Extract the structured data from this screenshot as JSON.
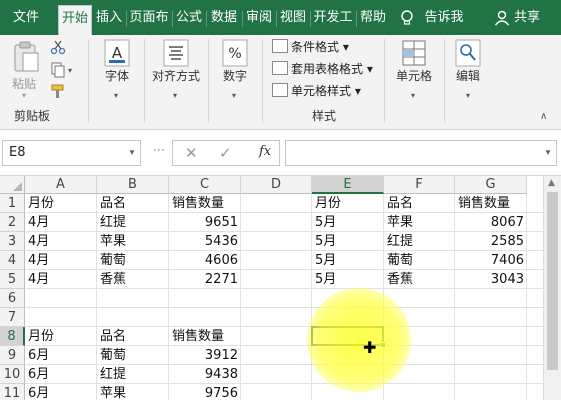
{
  "tabs": [
    {
      "label": "文件",
      "active": false
    },
    {
      "label": "开始",
      "active": true
    },
    {
      "label": "插入",
      "active": false
    },
    {
      "label": "页面布",
      "active": false
    },
    {
      "label": "公式",
      "active": false
    },
    {
      "label": "数据",
      "active": false
    },
    {
      "label": "审阅",
      "active": false
    },
    {
      "label": "视图",
      "active": false
    },
    {
      "label": "开发工",
      "active": false
    },
    {
      "label": "帮助",
      "active": false
    }
  ],
  "tell_me": {
    "icon": "lightbulb-icon",
    "label": "告诉我"
  },
  "share": {
    "icon": "person-icon",
    "label": "共享"
  },
  "ribbon": {
    "clipboard": {
      "paste_label": "粘贴",
      "group_name": "剪贴板"
    },
    "font": {
      "label": "字体"
    },
    "alignment": {
      "label": "对齐方式"
    },
    "number": {
      "label": "数字"
    },
    "styles": {
      "items": [
        "条件格式",
        "套用表格格式",
        "单元格样式"
      ],
      "group_name": "样式"
    },
    "cells": {
      "label": "单元格"
    },
    "editing": {
      "label": "编辑"
    }
  },
  "formula_bar": {
    "name_box": "E8",
    "fx_label": "fx",
    "formula": ""
  },
  "grid": {
    "columns": [
      "A",
      "B",
      "C",
      "D",
      "E",
      "F",
      "G"
    ],
    "selected_column": "E",
    "rows": [
      "1",
      "2",
      "3",
      "4",
      "5",
      "6",
      "7",
      "8",
      "9",
      "10",
      "11"
    ],
    "selected_row": "8",
    "table1": {
      "headers": [
        "月份",
        "品名",
        "销售数量"
      ],
      "rows": [
        [
          "4月",
          "红提",
          "9651"
        ],
        [
          "4月",
          "苹果",
          "5436"
        ],
        [
          "4月",
          "葡萄",
          "4606"
        ],
        [
          "4月",
          "香蕉",
          "2271"
        ]
      ]
    },
    "table2": {
      "headers": [
        "月份",
        "品名",
        "销售数量"
      ],
      "rows": [
        [
          "5月",
          "苹果",
          "8067"
        ],
        [
          "5月",
          "红提",
          "2585"
        ],
        [
          "5月",
          "葡萄",
          "7406"
        ],
        [
          "5月",
          "香蕉",
          "3043"
        ]
      ]
    },
    "table3": {
      "headers": [
        "月份",
        "品名",
        "销售数量"
      ],
      "rows": [
        [
          "6月",
          "葡萄",
          "3912"
        ],
        [
          "6月",
          "红提",
          "9438"
        ],
        [
          "6月",
          "苹果",
          "9756"
        ]
      ]
    }
  },
  "colors": {
    "accent": "#217346",
    "highlight": "#ffff33"
  }
}
